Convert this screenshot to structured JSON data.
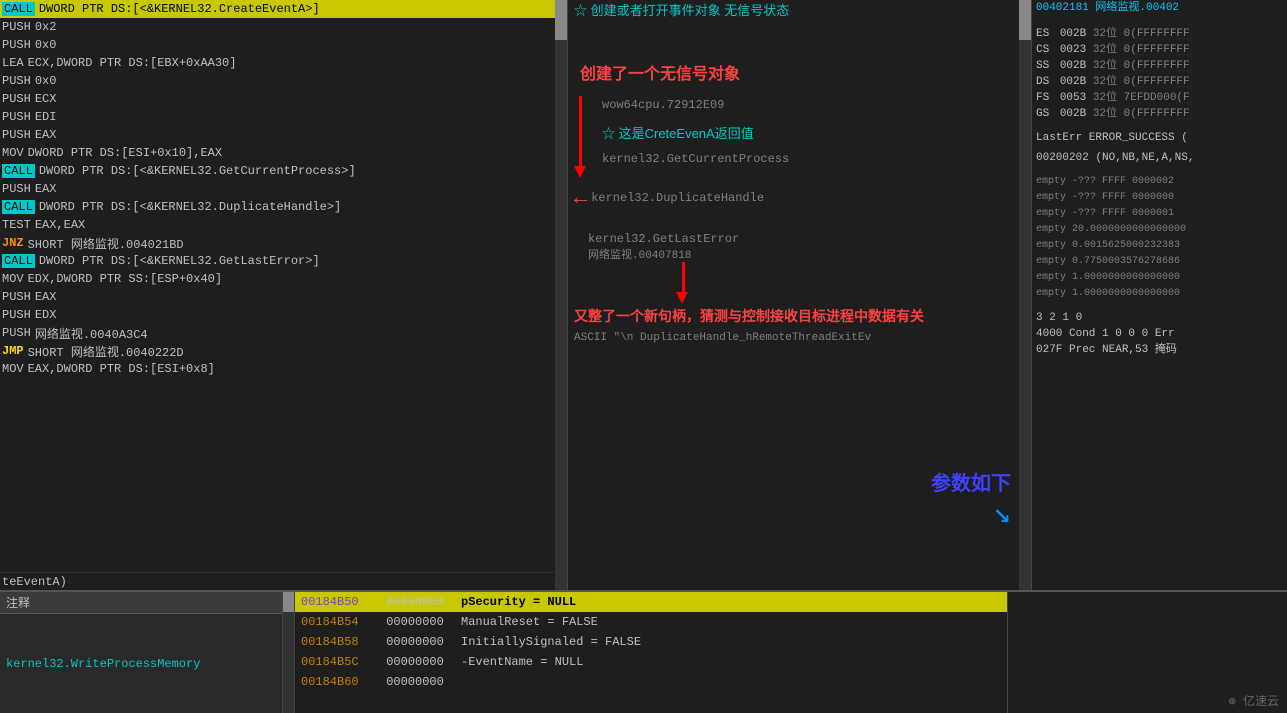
{
  "disasm": {
    "lines": [
      {
        "id": 0,
        "type": "call-highlighted",
        "mnemonic": "CALL",
        "operands": "DWORD PTR DS:[<&KERNEL32.CreateEventA>]"
      },
      {
        "id": 1,
        "type": "normal",
        "mnemonic": "PUSH",
        "operands": "0x2"
      },
      {
        "id": 2,
        "type": "normal",
        "mnemonic": "PUSH",
        "operands": "0x0"
      },
      {
        "id": 3,
        "type": "normal",
        "mnemonic": "LEA",
        "operands": "ECX,DWORD PTR DS:[EBX+0xAA30]"
      },
      {
        "id": 4,
        "type": "normal",
        "mnemonic": "PUSH",
        "operands": "0x0"
      },
      {
        "id": 5,
        "type": "normal",
        "mnemonic": "PUSH",
        "operands": "ECX"
      },
      {
        "id": 6,
        "type": "normal",
        "mnemonic": "PUSH",
        "operands": "EDI"
      },
      {
        "id": 7,
        "type": "normal",
        "mnemonic": "PUSH",
        "operands": "EAX"
      },
      {
        "id": 8,
        "type": "normal",
        "mnemonic": "MOV",
        "operands": "DWORD PTR DS:[ESI+0x10],EAX"
      },
      {
        "id": 9,
        "type": "call",
        "mnemonic": "CALL",
        "operands": "DWORD PTR DS:[<&KERNEL32.GetCurrentProcess>]"
      },
      {
        "id": 10,
        "type": "normal",
        "mnemonic": "PUSH",
        "operands": "EAX"
      },
      {
        "id": 11,
        "type": "call",
        "mnemonic": "CALL",
        "operands": "DWORD PTR DS:[<&KERNEL32.DuplicateHandle>]"
      },
      {
        "id": 12,
        "type": "normal",
        "mnemonic": "TEST",
        "operands": "EAX,EAX"
      },
      {
        "id": 13,
        "type": "jnz",
        "mnemonic": "JNZ",
        "operands": "SHORT 网络监视.004021BD"
      },
      {
        "id": 14,
        "type": "call",
        "mnemonic": "CALL",
        "operands": "DWORD PTR DS:[<&KERNEL32.GetLastError>]"
      },
      {
        "id": 15,
        "type": "normal",
        "mnemonic": "MOV",
        "operands": "EDX,DWORD PTR SS:[ESP+0x40]"
      },
      {
        "id": 16,
        "type": "normal",
        "mnemonic": "PUSH",
        "operands": "EAX"
      },
      {
        "id": 17,
        "type": "normal",
        "mnemonic": "PUSH",
        "operands": "EDX"
      },
      {
        "id": 18,
        "type": "normal",
        "mnemonic": "PUSH",
        "operands": "网络监视.0040A3C4"
      },
      {
        "id": 19,
        "type": "jmp",
        "mnemonic": "JMP",
        "operands": "SHORT 网络监视.0040222D"
      },
      {
        "id": 20,
        "type": "normal",
        "mnemonic": "MOV",
        "operands": "EAX,DWORD PTR DS:[ESI+0x8]"
      }
    ],
    "bottom_line": "teEventA)"
  },
  "comments": {
    "line0": "☆  创建或者打开事件对象   无信号状态",
    "big_comment1": "创建了一个无信号对象",
    "comment_wow": "wow64cpu.72912E09",
    "comment_creteevena": "☆  这是CreteEvenA返回值",
    "comment_getcurrentprocess": "kernel32.GetCurrentProcess",
    "comment_duplicatehandle": "kernel32.DuplicateHandle",
    "comment_getlasterror": "kernel32.GetLastError",
    "comment_wangjian": "网络监视.00407818",
    "big_comment2": "又整了一个新句柄，猜测与控制接收目标进程中数据有关",
    "comment_ascii": "ASCII \"\\n DuplicateHandle_hRemoteThreadExitEv",
    "big_comment3": "参数如下"
  },
  "registers": {
    "header": "00402181  网络监视.00402",
    "regs": [
      {
        "name": "ES",
        "val": "002B",
        "bits": "32位",
        "extra": "0(FFFFFFFF"
      },
      {
        "name": "CS",
        "val": "0023",
        "bits": "32位",
        "extra": "0(FFFFFFFF"
      },
      {
        "name": "SS",
        "val": "002B",
        "bits": "32位",
        "extra": "0(FFFFFFFF"
      },
      {
        "name": "DS",
        "val": "002B",
        "bits": "32位",
        "extra": "0(FFFFFFFF"
      },
      {
        "name": "FS",
        "val": "0053",
        "bits": "32位",
        "extra": "7EFDD000(F"
      },
      {
        "name": "GS",
        "val": "002B",
        "bits": "32位",
        "extra": "0(FFFFFFFF"
      }
    ],
    "lasterr": "LastErr ERROR_SUCCESS (",
    "flags1": "00200202  (NO,NB,NE,A,NS,",
    "empty_lines": [
      "empty -??? FFFF 0000002",
      "empty -??? FFFF 0000000",
      "empty -??? FFFF 0000001",
      "empty 20.0000000000000000",
      "empty 0.0015625000232383",
      "empty 0.7750003576278686",
      "empty 1.0000000000000000",
      "empty 1.0000000000000000"
    ],
    "num_line": "3 2 1 0",
    "cond_line": "4000  Cond 1 0 0 0  Err",
    "prec_line": "027F  Prec NEAR,53  掩码"
  },
  "bottom": {
    "label_notes": "注释",
    "note_link": "kernel32.WriteProcessMemory",
    "mem_rows": [
      {
        "addr": "00184B50",
        "hex": "00000000",
        "ascii": "pSecurity = NULL",
        "highlight": true
      },
      {
        "addr": "00184B54",
        "hex": "00000000",
        "ascii": "ManualReset = FALSE"
      },
      {
        "addr": "00184B58",
        "hex": "00000000",
        "ascii": "InitiallySignaled = FALSE"
      },
      {
        "addr": "00184B5C",
        "hex": "00000000",
        "ascii": "-EventName = NULL"
      },
      {
        "addr": "00184B60",
        "hex": "00000000",
        "ascii": ""
      }
    ]
  },
  "watermark": "⊕ 亿速云"
}
